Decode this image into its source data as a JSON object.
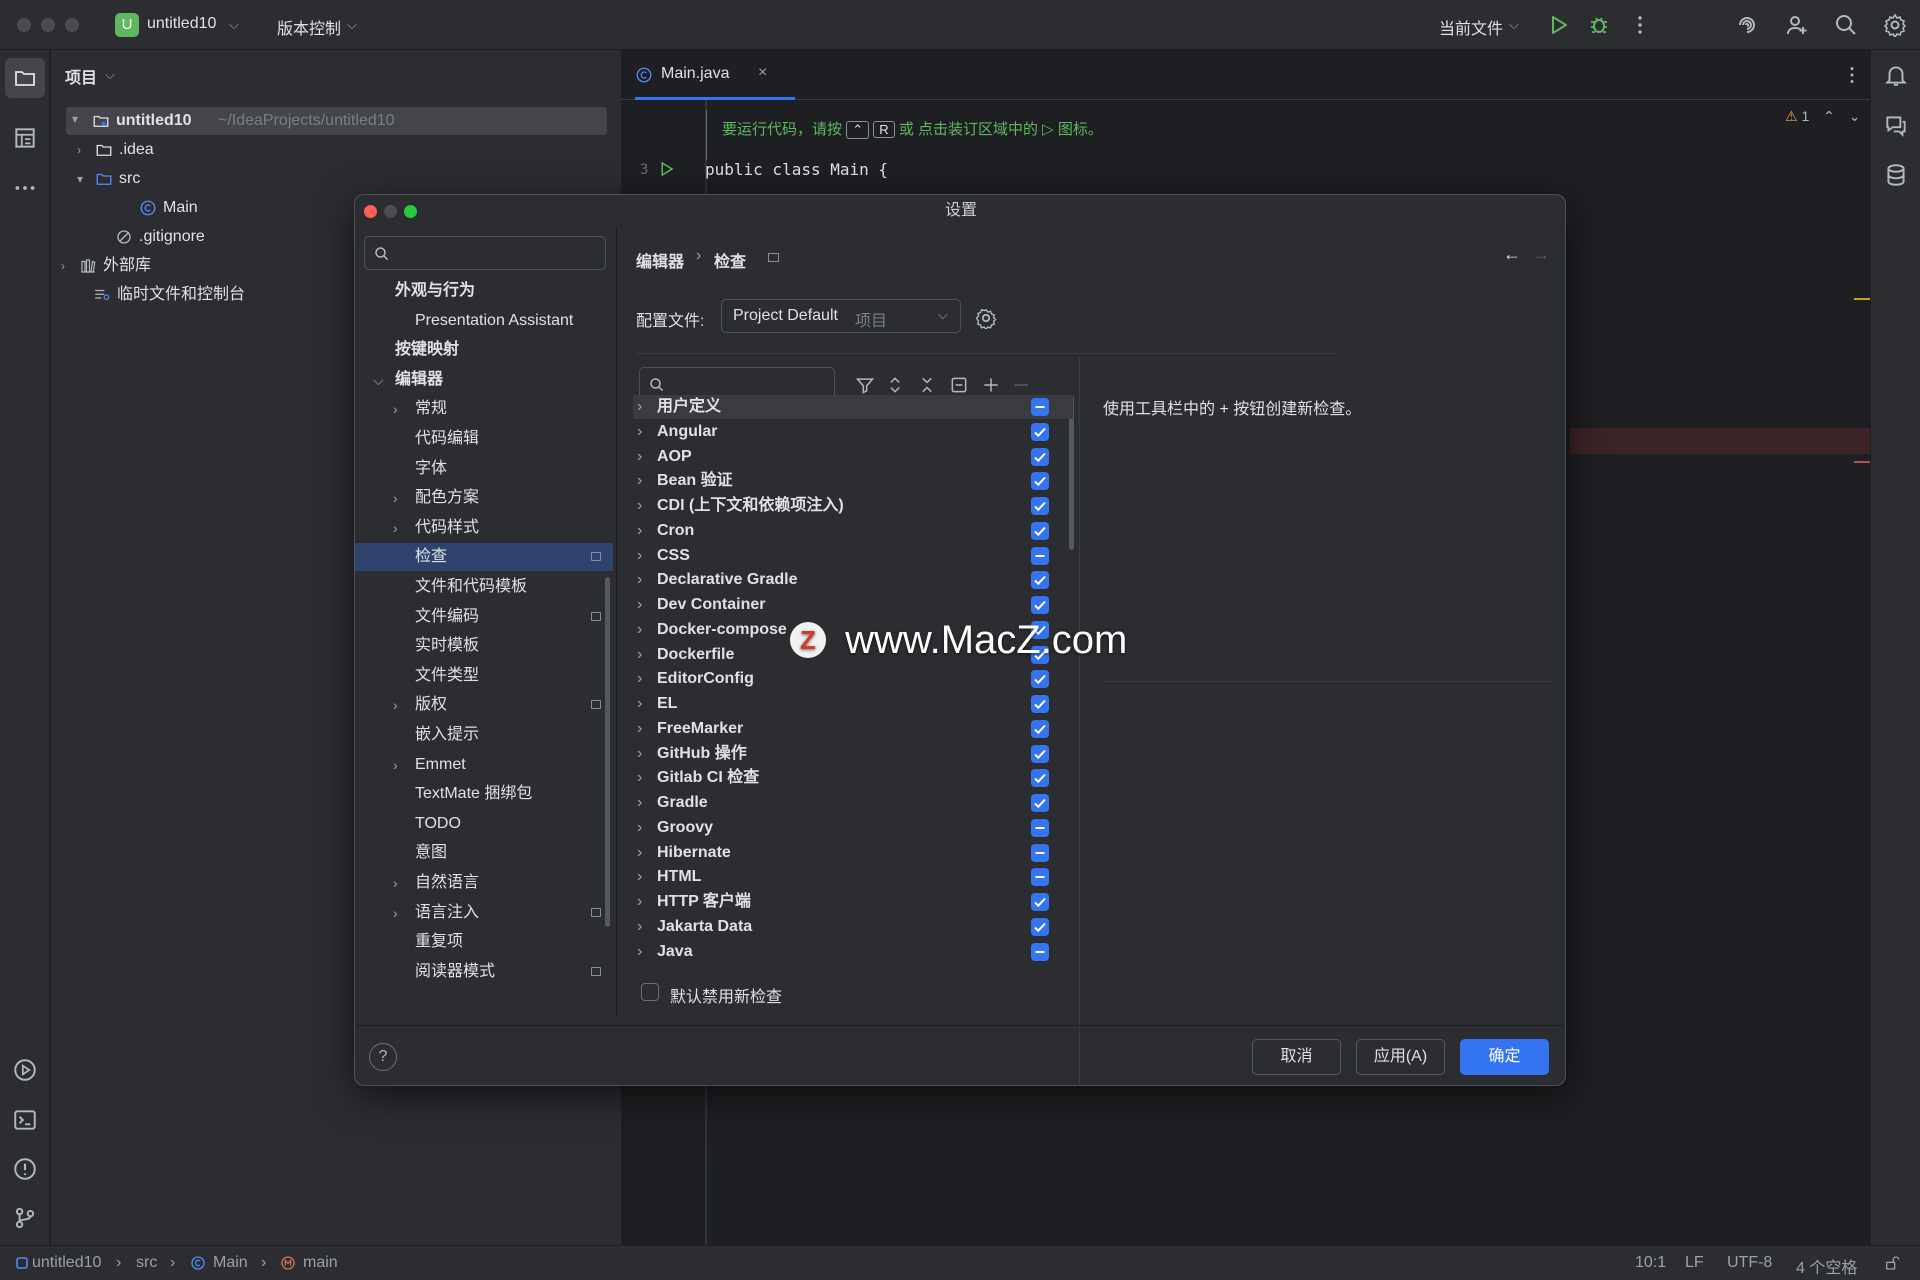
{
  "app": {
    "project_badge": "U",
    "project_name": "untitled10",
    "vcs_menu": "版本控制",
    "run_config": "当前文件"
  },
  "project_panel": {
    "title": "项目",
    "root_name": "untitled10",
    "root_path": "~/IdeaProjects/untitled10",
    "items": [
      ".idea",
      "src",
      "Main",
      ".gitignore",
      "外部库",
      "临时文件和控制台"
    ]
  },
  "editor": {
    "tab_label": "Main.java",
    "hint_prefix": "要运行代码，请按",
    "hint_key1": "⌃",
    "hint_key2": "R",
    "hint_suffix": "或 点击装订区域中的",
    "hint_end": "图标。",
    "line_number": "3",
    "code_line": "public class Main {",
    "warning_count": "1"
  },
  "dialog": {
    "title": "设置",
    "breadcrumb_1": "编辑器",
    "breadcrumb_2": "检查",
    "profile_label": "配置文件:",
    "profile_value": "Project Default",
    "profile_scope": "项目",
    "help_text": "使用工具栏中的 + 按钮创建新检查。",
    "disable_new_label": "默认禁用新检查",
    "cancel_label": "取消",
    "apply_label": "应用(A)",
    "ok_label": "确定",
    "help_icon": "?"
  },
  "nav": [
    {
      "label": "外观与行为",
      "level": 0,
      "bold": true,
      "chev": ""
    },
    {
      "label": "Presentation Assistant",
      "level": 2,
      "bold": false,
      "chev": ""
    },
    {
      "label": "按键映射",
      "level": 0,
      "bold": true,
      "chev": ""
    },
    {
      "label": "编辑器",
      "level": 0,
      "bold": true,
      "chev": "down"
    },
    {
      "label": "常规",
      "level": 1,
      "bold": false,
      "chev": "right"
    },
    {
      "label": "代码编辑",
      "level": 2,
      "bold": false,
      "chev": ""
    },
    {
      "label": "字体",
      "level": 2,
      "bold": false,
      "chev": ""
    },
    {
      "label": "配色方案",
      "level": 1,
      "bold": false,
      "chev": "right"
    },
    {
      "label": "代码样式",
      "level": 1,
      "bold": false,
      "chev": "right"
    },
    {
      "label": "检查",
      "level": 2,
      "bold": false,
      "chev": "",
      "selected": true,
      "badge": true
    },
    {
      "label": "文件和代码模板",
      "level": 2,
      "bold": false,
      "chev": ""
    },
    {
      "label": "文件编码",
      "level": 2,
      "bold": false,
      "chev": "",
      "badge": true
    },
    {
      "label": "实时模板",
      "level": 2,
      "bold": false,
      "chev": ""
    },
    {
      "label": "文件类型",
      "level": 2,
      "bold": false,
      "chev": ""
    },
    {
      "label": "版权",
      "level": 1,
      "bold": false,
      "chev": "right",
      "badge": true
    },
    {
      "label": "嵌入提示",
      "level": 2,
      "bold": false,
      "chev": ""
    },
    {
      "label": "Emmet",
      "level": 1,
      "bold": false,
      "chev": "right"
    },
    {
      "label": "TextMate 捆绑包",
      "level": 2,
      "bold": false,
      "chev": ""
    },
    {
      "label": "TODO",
      "level": 2,
      "bold": false,
      "chev": ""
    },
    {
      "label": "意图",
      "level": 2,
      "bold": false,
      "chev": ""
    },
    {
      "label": "自然语言",
      "level": 1,
      "bold": false,
      "chev": "right"
    },
    {
      "label": "语言注入",
      "level": 1,
      "bold": false,
      "chev": "right",
      "badge": true
    },
    {
      "label": "重复项",
      "level": 2,
      "bold": false,
      "chev": ""
    },
    {
      "label": "阅读器模式",
      "level": 2,
      "bold": false,
      "chev": "",
      "badge": true
    }
  ],
  "inspections": [
    {
      "name": "用户定义",
      "state": "partial"
    },
    {
      "name": "Angular",
      "state": "checked"
    },
    {
      "name": "AOP",
      "state": "checked"
    },
    {
      "name": "Bean 验证",
      "state": "checked"
    },
    {
      "name": "CDI (上下文和依赖项注入)",
      "state": "checked"
    },
    {
      "name": "Cron",
      "state": "checked"
    },
    {
      "name": "CSS",
      "state": "partial"
    },
    {
      "name": "Declarative Gradle",
      "state": "checked"
    },
    {
      "name": "Dev Container",
      "state": "checked"
    },
    {
      "name": "Docker-compose",
      "state": "checked"
    },
    {
      "name": "Dockerfile",
      "state": "checked"
    },
    {
      "name": "EditorConfig",
      "state": "checked"
    },
    {
      "name": "EL",
      "state": "checked"
    },
    {
      "name": "FreeMarker",
      "state": "checked"
    },
    {
      "name": "GitHub 操作",
      "state": "checked"
    },
    {
      "name": "Gitlab CI 检查",
      "state": "checked"
    },
    {
      "name": "Gradle",
      "state": "checked"
    },
    {
      "name": "Groovy",
      "state": "partial"
    },
    {
      "name": "Hibernate",
      "state": "partial"
    },
    {
      "name": "HTML",
      "state": "partial"
    },
    {
      "name": "HTTP 客户端",
      "state": "checked"
    },
    {
      "name": "Jakarta Data",
      "state": "checked"
    },
    {
      "name": "Java",
      "state": "partial"
    }
  ],
  "statusbar": {
    "crumb_project": "untitled10",
    "crumb_src": "src",
    "crumb_class": "Main",
    "crumb_method": "main",
    "position": "10:1",
    "line_sep": "LF",
    "encoding": "UTF-8",
    "indent": "4 个空格"
  },
  "watermark": "www.MacZ.com",
  "colors": {
    "accent": "#3574f0",
    "selection": "#2e436e",
    "run_green": "#5fb760"
  }
}
